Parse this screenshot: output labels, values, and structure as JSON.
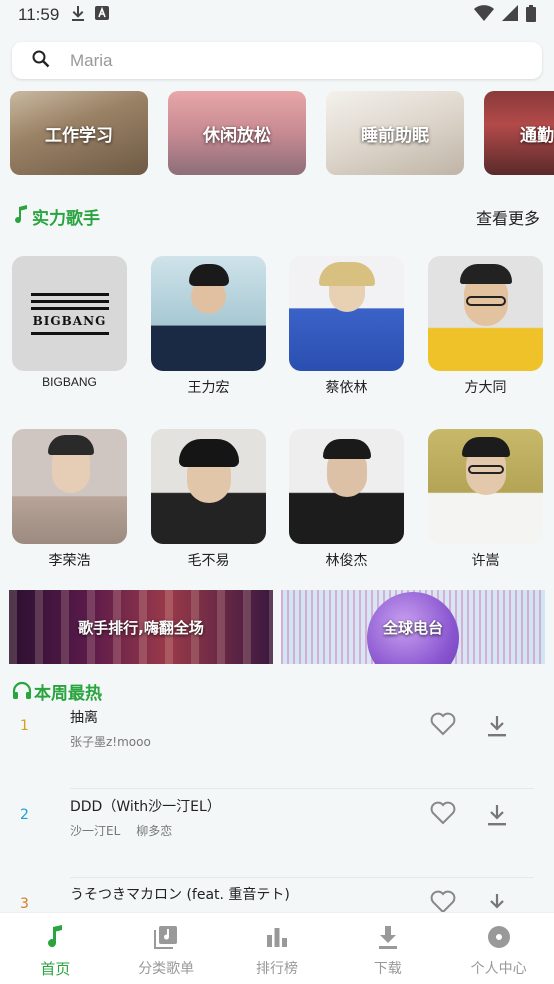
{
  "status_bar": {
    "time": "11:59"
  },
  "search": {
    "placeholder": "Maria"
  },
  "categories": [
    {
      "label": "工作学习"
    },
    {
      "label": "休闲放松"
    },
    {
      "label": "睡前助眠"
    },
    {
      "label": "通勤"
    }
  ],
  "singers_section": {
    "title": "实力歌手",
    "more": "查看更多"
  },
  "singers": [
    {
      "name": "BIGBANG",
      "logo_text": "BIGBANG"
    },
    {
      "name": "王力宏"
    },
    {
      "name": "蔡依林"
    },
    {
      "name": "方大同"
    },
    {
      "name": "李荣浩"
    },
    {
      "name": "毛不易"
    },
    {
      "name": "林俊杰"
    },
    {
      "name": "许嵩"
    }
  ],
  "banners": [
    {
      "label": "歌手排行,嗨翻全场"
    },
    {
      "label": "全球电台"
    }
  ],
  "hot_section": {
    "title": "本周最热"
  },
  "songs": [
    {
      "rank": "1",
      "title": "抽离",
      "artists": [
        "张子墨z!mooo"
      ],
      "rank_color": "#d8a020"
    },
    {
      "rank": "2",
      "title": "DDD（With沙一汀EL）",
      "artists": [
        "沙一汀EL",
        "柳多恋"
      ],
      "rank_color": "#1aa0d8"
    },
    {
      "rank": "3",
      "title": "うそつきマカロン (feat. 重音テト)",
      "artists": [],
      "rank_color": "#d87a20"
    }
  ],
  "bottom_nav": [
    {
      "label": "首页",
      "active": true
    },
    {
      "label": "分类歌单"
    },
    {
      "label": "排行榜"
    },
    {
      "label": "下载"
    },
    {
      "label": "个人中心"
    }
  ],
  "colors": {
    "accent": "#2aa43f"
  }
}
